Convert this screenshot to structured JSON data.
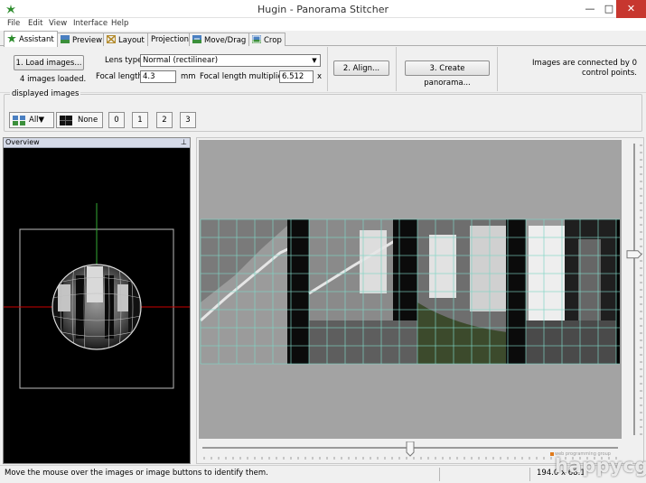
{
  "window": {
    "title": "Hugin - Panorama Stitcher",
    "minimize": "—",
    "maximize": "□",
    "close": "✕"
  },
  "menu": [
    "File",
    "Edit",
    "View",
    "Interface",
    "Help"
  ],
  "tabs": [
    {
      "label": "Assistant",
      "icon": "assistant-icon",
      "active": true
    },
    {
      "label": "Preview",
      "icon": "preview-icon",
      "active": false
    },
    {
      "label": "Layout",
      "icon": "layout-icon",
      "active": false
    },
    {
      "label": "Projection",
      "icon": "",
      "active": false
    },
    {
      "label": "Move/Drag",
      "icon": "move-drag-icon",
      "active": false
    },
    {
      "label": "Crop",
      "icon": "crop-icon",
      "active": false
    }
  ],
  "assistant": {
    "load_button": "1. Load images...",
    "images_loaded": "4 images loaded.",
    "lens_type_label": "Lens type:",
    "lens_type_value": "Normal (rectilinear)",
    "focal_length_label": "Focal length:",
    "focal_length_value": "4.3",
    "focal_length_unit": "mm",
    "multiplier_label": "Focal length multiplier:",
    "multiplier_value": "6.512",
    "multiplier_unit": "x",
    "align_button": "2. Align...",
    "create_button": "3. Create panorama...",
    "connection_status": "Images are connected by 0 control points."
  },
  "displayed_images": {
    "title": "displayed images",
    "all_label": "All▼",
    "none_label": "None",
    "image_buttons": [
      "0",
      "1",
      "2",
      "3"
    ]
  },
  "overview": {
    "title": "Overview",
    "pin_icon": "pin-icon"
  },
  "preview": {
    "image_count": 4,
    "vertical_slider_level": 0.38,
    "horizontal_slider_level": 0.5
  },
  "statusbar": {
    "text": "Move the mouse over the images or image buttons to identify them.",
    "fov": "194.0 x 68.1"
  },
  "watermark": {
    "small": "web programming group",
    "big": "happycgi"
  },
  "colors": {
    "titlebar_bg": "#ffffff",
    "close_button": "#c7372f",
    "canvas_bg": "#a3a3a3",
    "grid_line": "#7fd4c4",
    "overview_bg": "#000000",
    "overview_h_axis": "#cc0000",
    "overview_v_axis": "#33aa33"
  }
}
